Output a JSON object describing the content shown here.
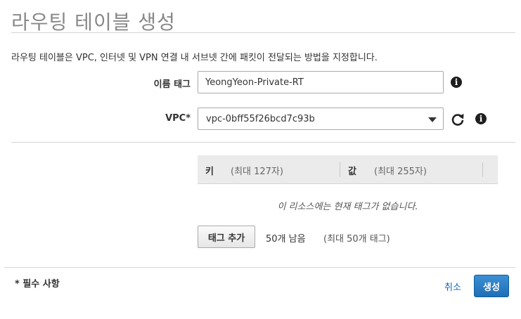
{
  "page": {
    "title": "라우팅 테이블 생성",
    "description": "라우팅 테이블은 VPC, 인터넷 및 VPN 연결 내 서브넷 간에 패킷이 전달되는 방법을 지정합니다."
  },
  "form": {
    "name_tag_label": "이름 태그",
    "name_tag_value": "YeongYeon-Private-RT",
    "vpc_label": "VPC*",
    "vpc_value": "vpc-0bff55f26bcd7c93b"
  },
  "icons": {
    "info": "info-icon",
    "refresh": "refresh-icon",
    "caret": "chevron-down-icon"
  },
  "tags": {
    "key_header": "키",
    "key_hint": "(최대 127자)",
    "value_header": "값",
    "value_hint": "(최대 255자)",
    "empty_message": "이 리소스에는 현재 태그가 없습니다.",
    "add_button_label": "태그 추가",
    "remaining": "50개 남음",
    "remaining_hint": "(최대 50개 태그)"
  },
  "footer": {
    "required_note": "* 필수 사항",
    "cancel_label": "취소",
    "create_label": "생성"
  },
  "colors": {
    "primary_button": "#2a7dc6",
    "link": "#1166bb",
    "title": "#888888"
  }
}
